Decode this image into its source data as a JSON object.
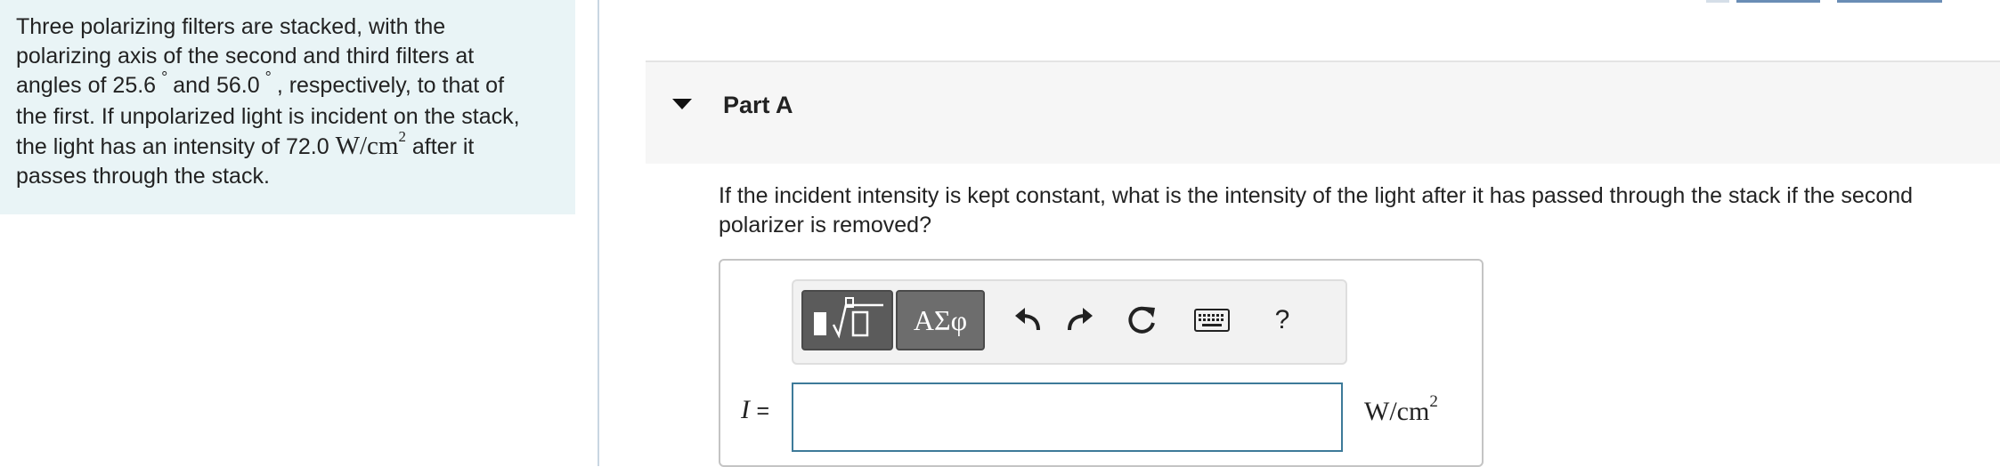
{
  "problem": {
    "line1": "Three polarizing filters are stacked, with the",
    "line2": "polarizing axis of the second and third filters at",
    "line3_a": "angles of 25.6",
    "line3_b": "and 56.0",
    "line3_c": ", respectively, to that of",
    "degree_symbol": "°",
    "line4": "the first. If unpolarized light is incident on the stack,",
    "line5_a": "the light has an intensity of 72.0",
    "line5_unit": "W/cm",
    "line5_exp": "2",
    "line5_b": "after it",
    "line6": "passes through the stack."
  },
  "part": {
    "title": "Part A",
    "question": "If the incident intensity is kept constant, what is the intensity of the light after it has passed through the stack if the second polarizer is removed?"
  },
  "toolbar": {
    "templates_label": "▮√▯",
    "symbols_label": "ΑΣφ",
    "undo_icon": "undo-icon",
    "redo_icon": "redo-icon",
    "reset_icon": "reset-icon",
    "keyboard_icon": "keyboard-icon",
    "help_label": "?"
  },
  "answer": {
    "variable": "I",
    "equals": "=",
    "value": "",
    "unit": "W/cm",
    "unit_exp": "2"
  },
  "colors": {
    "problem_bg": "#e9f4f6",
    "input_border": "#3d7a99",
    "top_tab": "#6a8db5"
  }
}
